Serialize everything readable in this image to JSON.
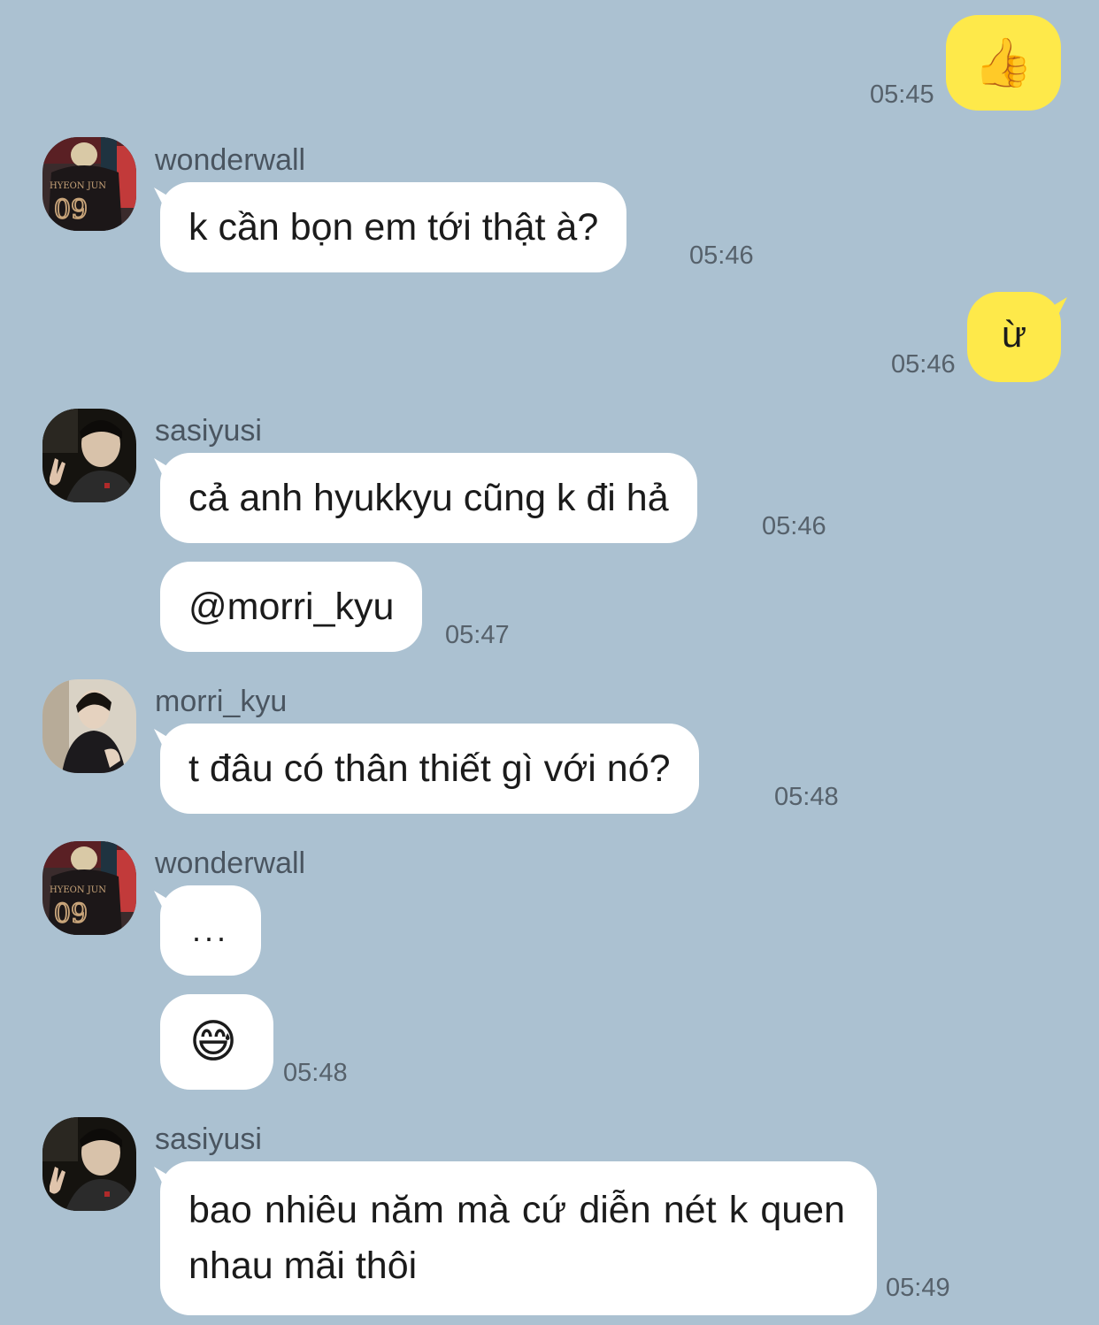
{
  "messages": [
    {
      "sender": "me",
      "text": "👍",
      "time": "05:45"
    },
    {
      "sender": "wonderwall",
      "text": "k cần bọn em tới thật à?",
      "time": "05:46"
    },
    {
      "sender": "me",
      "text": "ừ",
      "time": "05:46"
    },
    {
      "sender": "sasiyusi",
      "text": "cả anh hyukkyu cũng k đi hả",
      "time": "05:46"
    },
    {
      "sender": "sasiyusi",
      "text": "@morri_kyu",
      "time": "05:47"
    },
    {
      "sender": "morri_kyu",
      "text": "t đâu có thân thiết gì với nó?",
      "time": "05:48"
    },
    {
      "sender": "wonderwall",
      "text": "..."
    },
    {
      "sender": "wonderwall",
      "text": "😅",
      "time": "05:48"
    },
    {
      "sender": "sasiyusi",
      "text": "bao nhiêu năm mà cứ diễn nét k quen nhau mãi thôi",
      "time": "05:49"
    }
  ],
  "avatar_jersey": {
    "name": "HYEON JUN",
    "number": "09"
  },
  "colors": {
    "background": "#abc1d1",
    "my_bubble": "#fee94a",
    "their_bubble": "#ffffff",
    "time_text": "#56616b",
    "name_text": "#4a5560"
  }
}
